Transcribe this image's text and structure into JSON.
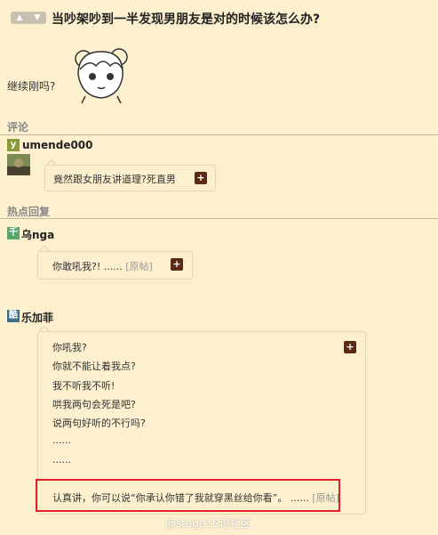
{
  "post": {
    "vote_up_icon": "thumbs-up-icon",
    "vote_down_icon": "thumbs-down-icon",
    "title": "当吵架吵到一半发现男朋友是对的时候该怎么办?",
    "body": "继续刚吗?"
  },
  "comments": {
    "label": "评论",
    "items": [
      {
        "username": "umende000",
        "avatar_letter": "y",
        "text": "竟然跟女朋友讲道理?死直男",
        "plus": "+"
      }
    ]
  },
  "hot": {
    "label": "热点回复",
    "items": [
      {
        "username": "乌nga",
        "avatar_letter": "千",
        "text": "你敢吼我?!",
        "ellipsis": "......",
        "orig": "[原帖]",
        "plus": "+"
      },
      {
        "username": "乐加菲",
        "avatar_letter": "酷",
        "lines": [
          "你吼我?",
          "你就不能让着我点?",
          "我不听我不听!",
          "哄我两句会死是吧?",
          "说两句好听的不行吗?",
          "......",
          "......"
        ],
        "last_line": "认真讲，你可以说“你承认你错了我就穿黑丝给你看”。",
        "ellipsis": "......",
        "orig": "[原帖]",
        "plus": "+"
      }
    ]
  },
  "watermark": "@stage1S论社区",
  "colors": {
    "background": "#fdf0cf",
    "plus_button": "#5a2a14",
    "highlight_box": "#e0202a"
  }
}
